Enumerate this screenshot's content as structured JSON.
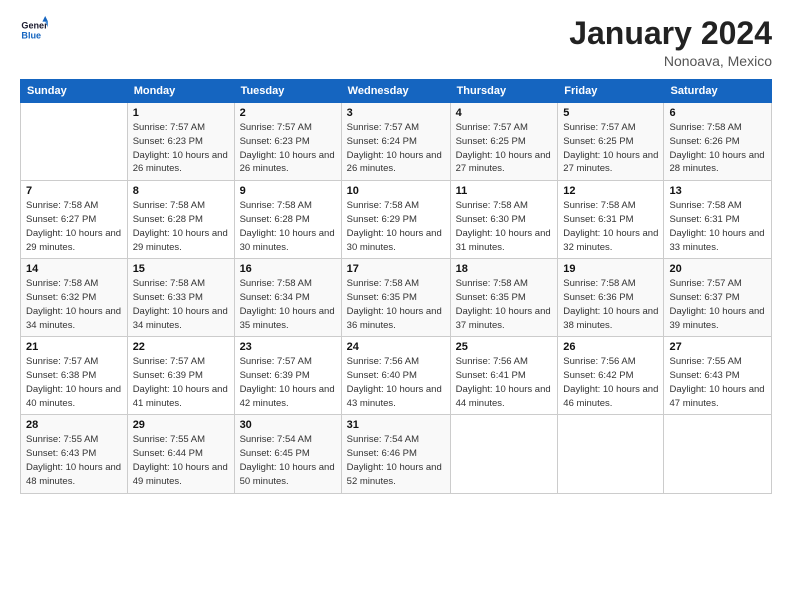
{
  "logo": {
    "line1": "General",
    "line2": "Blue"
  },
  "title": "January 2024",
  "location": "Nonoava, Mexico",
  "days_of_week": [
    "Sunday",
    "Monday",
    "Tuesday",
    "Wednesday",
    "Thursday",
    "Friday",
    "Saturday"
  ],
  "weeks": [
    [
      {
        "day": "",
        "sunrise": "",
        "sunset": "",
        "daylight": ""
      },
      {
        "day": "1",
        "sunrise": "Sunrise: 7:57 AM",
        "sunset": "Sunset: 6:23 PM",
        "daylight": "Daylight: 10 hours and 26 minutes."
      },
      {
        "day": "2",
        "sunrise": "Sunrise: 7:57 AM",
        "sunset": "Sunset: 6:23 PM",
        "daylight": "Daylight: 10 hours and 26 minutes."
      },
      {
        "day": "3",
        "sunrise": "Sunrise: 7:57 AM",
        "sunset": "Sunset: 6:24 PM",
        "daylight": "Daylight: 10 hours and 26 minutes."
      },
      {
        "day": "4",
        "sunrise": "Sunrise: 7:57 AM",
        "sunset": "Sunset: 6:25 PM",
        "daylight": "Daylight: 10 hours and 27 minutes."
      },
      {
        "day": "5",
        "sunrise": "Sunrise: 7:57 AM",
        "sunset": "Sunset: 6:25 PM",
        "daylight": "Daylight: 10 hours and 27 minutes."
      },
      {
        "day": "6",
        "sunrise": "Sunrise: 7:58 AM",
        "sunset": "Sunset: 6:26 PM",
        "daylight": "Daylight: 10 hours and 28 minutes."
      }
    ],
    [
      {
        "day": "7",
        "sunrise": "Sunrise: 7:58 AM",
        "sunset": "Sunset: 6:27 PM",
        "daylight": "Daylight: 10 hours and 29 minutes."
      },
      {
        "day": "8",
        "sunrise": "Sunrise: 7:58 AM",
        "sunset": "Sunset: 6:28 PM",
        "daylight": "Daylight: 10 hours and 29 minutes."
      },
      {
        "day": "9",
        "sunrise": "Sunrise: 7:58 AM",
        "sunset": "Sunset: 6:28 PM",
        "daylight": "Daylight: 10 hours and 30 minutes."
      },
      {
        "day": "10",
        "sunrise": "Sunrise: 7:58 AM",
        "sunset": "Sunset: 6:29 PM",
        "daylight": "Daylight: 10 hours and 30 minutes."
      },
      {
        "day": "11",
        "sunrise": "Sunrise: 7:58 AM",
        "sunset": "Sunset: 6:30 PM",
        "daylight": "Daylight: 10 hours and 31 minutes."
      },
      {
        "day": "12",
        "sunrise": "Sunrise: 7:58 AM",
        "sunset": "Sunset: 6:31 PM",
        "daylight": "Daylight: 10 hours and 32 minutes."
      },
      {
        "day": "13",
        "sunrise": "Sunrise: 7:58 AM",
        "sunset": "Sunset: 6:31 PM",
        "daylight": "Daylight: 10 hours and 33 minutes."
      }
    ],
    [
      {
        "day": "14",
        "sunrise": "Sunrise: 7:58 AM",
        "sunset": "Sunset: 6:32 PM",
        "daylight": "Daylight: 10 hours and 34 minutes."
      },
      {
        "day": "15",
        "sunrise": "Sunrise: 7:58 AM",
        "sunset": "Sunset: 6:33 PM",
        "daylight": "Daylight: 10 hours and 34 minutes."
      },
      {
        "day": "16",
        "sunrise": "Sunrise: 7:58 AM",
        "sunset": "Sunset: 6:34 PM",
        "daylight": "Daylight: 10 hours and 35 minutes."
      },
      {
        "day": "17",
        "sunrise": "Sunrise: 7:58 AM",
        "sunset": "Sunset: 6:35 PM",
        "daylight": "Daylight: 10 hours and 36 minutes."
      },
      {
        "day": "18",
        "sunrise": "Sunrise: 7:58 AM",
        "sunset": "Sunset: 6:35 PM",
        "daylight": "Daylight: 10 hours and 37 minutes."
      },
      {
        "day": "19",
        "sunrise": "Sunrise: 7:58 AM",
        "sunset": "Sunset: 6:36 PM",
        "daylight": "Daylight: 10 hours and 38 minutes."
      },
      {
        "day": "20",
        "sunrise": "Sunrise: 7:57 AM",
        "sunset": "Sunset: 6:37 PM",
        "daylight": "Daylight: 10 hours and 39 minutes."
      }
    ],
    [
      {
        "day": "21",
        "sunrise": "Sunrise: 7:57 AM",
        "sunset": "Sunset: 6:38 PM",
        "daylight": "Daylight: 10 hours and 40 minutes."
      },
      {
        "day": "22",
        "sunrise": "Sunrise: 7:57 AM",
        "sunset": "Sunset: 6:39 PM",
        "daylight": "Daylight: 10 hours and 41 minutes."
      },
      {
        "day": "23",
        "sunrise": "Sunrise: 7:57 AM",
        "sunset": "Sunset: 6:39 PM",
        "daylight": "Daylight: 10 hours and 42 minutes."
      },
      {
        "day": "24",
        "sunrise": "Sunrise: 7:56 AM",
        "sunset": "Sunset: 6:40 PM",
        "daylight": "Daylight: 10 hours and 43 minutes."
      },
      {
        "day": "25",
        "sunrise": "Sunrise: 7:56 AM",
        "sunset": "Sunset: 6:41 PM",
        "daylight": "Daylight: 10 hours and 44 minutes."
      },
      {
        "day": "26",
        "sunrise": "Sunrise: 7:56 AM",
        "sunset": "Sunset: 6:42 PM",
        "daylight": "Daylight: 10 hours and 46 minutes."
      },
      {
        "day": "27",
        "sunrise": "Sunrise: 7:55 AM",
        "sunset": "Sunset: 6:43 PM",
        "daylight": "Daylight: 10 hours and 47 minutes."
      }
    ],
    [
      {
        "day": "28",
        "sunrise": "Sunrise: 7:55 AM",
        "sunset": "Sunset: 6:43 PM",
        "daylight": "Daylight: 10 hours and 48 minutes."
      },
      {
        "day": "29",
        "sunrise": "Sunrise: 7:55 AM",
        "sunset": "Sunset: 6:44 PM",
        "daylight": "Daylight: 10 hours and 49 minutes."
      },
      {
        "day": "30",
        "sunrise": "Sunrise: 7:54 AM",
        "sunset": "Sunset: 6:45 PM",
        "daylight": "Daylight: 10 hours and 50 minutes."
      },
      {
        "day": "31",
        "sunrise": "Sunrise: 7:54 AM",
        "sunset": "Sunset: 6:46 PM",
        "daylight": "Daylight: 10 hours and 52 minutes."
      },
      {
        "day": "",
        "sunrise": "",
        "sunset": "",
        "daylight": ""
      },
      {
        "day": "",
        "sunrise": "",
        "sunset": "",
        "daylight": ""
      },
      {
        "day": "",
        "sunrise": "",
        "sunset": "",
        "daylight": ""
      }
    ]
  ]
}
